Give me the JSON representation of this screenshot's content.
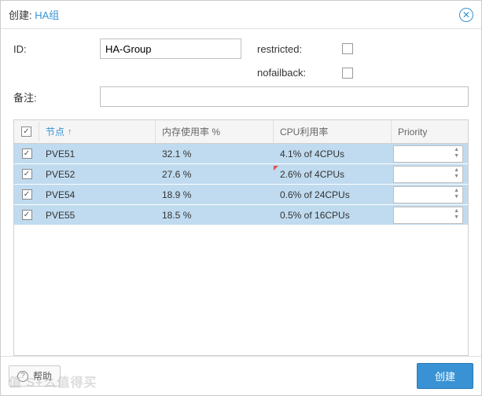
{
  "title": {
    "prefix": "创建: ",
    "suffix": "HA组"
  },
  "form": {
    "id_label": "ID:",
    "id_value": "HA-Group",
    "restricted_label": "restricted:",
    "restricted_checked": false,
    "nofailback_label": "nofailback:",
    "nofailback_checked": false,
    "comment_label": "备注:",
    "comment_value": ""
  },
  "table": {
    "headers": {
      "node": "节点",
      "memory": "内存使用率 %",
      "cpu": "CPU利用率",
      "priority": "Priority"
    },
    "sort_indicator": "↑",
    "header_checked": true,
    "rows": [
      {
        "checked": true,
        "node": "PVE51",
        "memory": "32.1 %",
        "cpu": "4.1% of 4CPUs",
        "priority": "",
        "dirty": false
      },
      {
        "checked": true,
        "node": "PVE52",
        "memory": "27.6 %",
        "cpu": "2.6% of 4CPUs",
        "priority": "",
        "dirty": true
      },
      {
        "checked": true,
        "node": "PVE54",
        "memory": "18.9 %",
        "cpu": "0.6% of 24CPUs",
        "priority": "",
        "dirty": false
      },
      {
        "checked": true,
        "node": "PVE55",
        "memory": "18.5 %",
        "cpu": "0.5% of 16CPUs",
        "priority": "",
        "dirty": false
      }
    ]
  },
  "footer": {
    "help_label": "帮助",
    "create_label": "创建"
  },
  "watermark": "值 S+么值得买"
}
